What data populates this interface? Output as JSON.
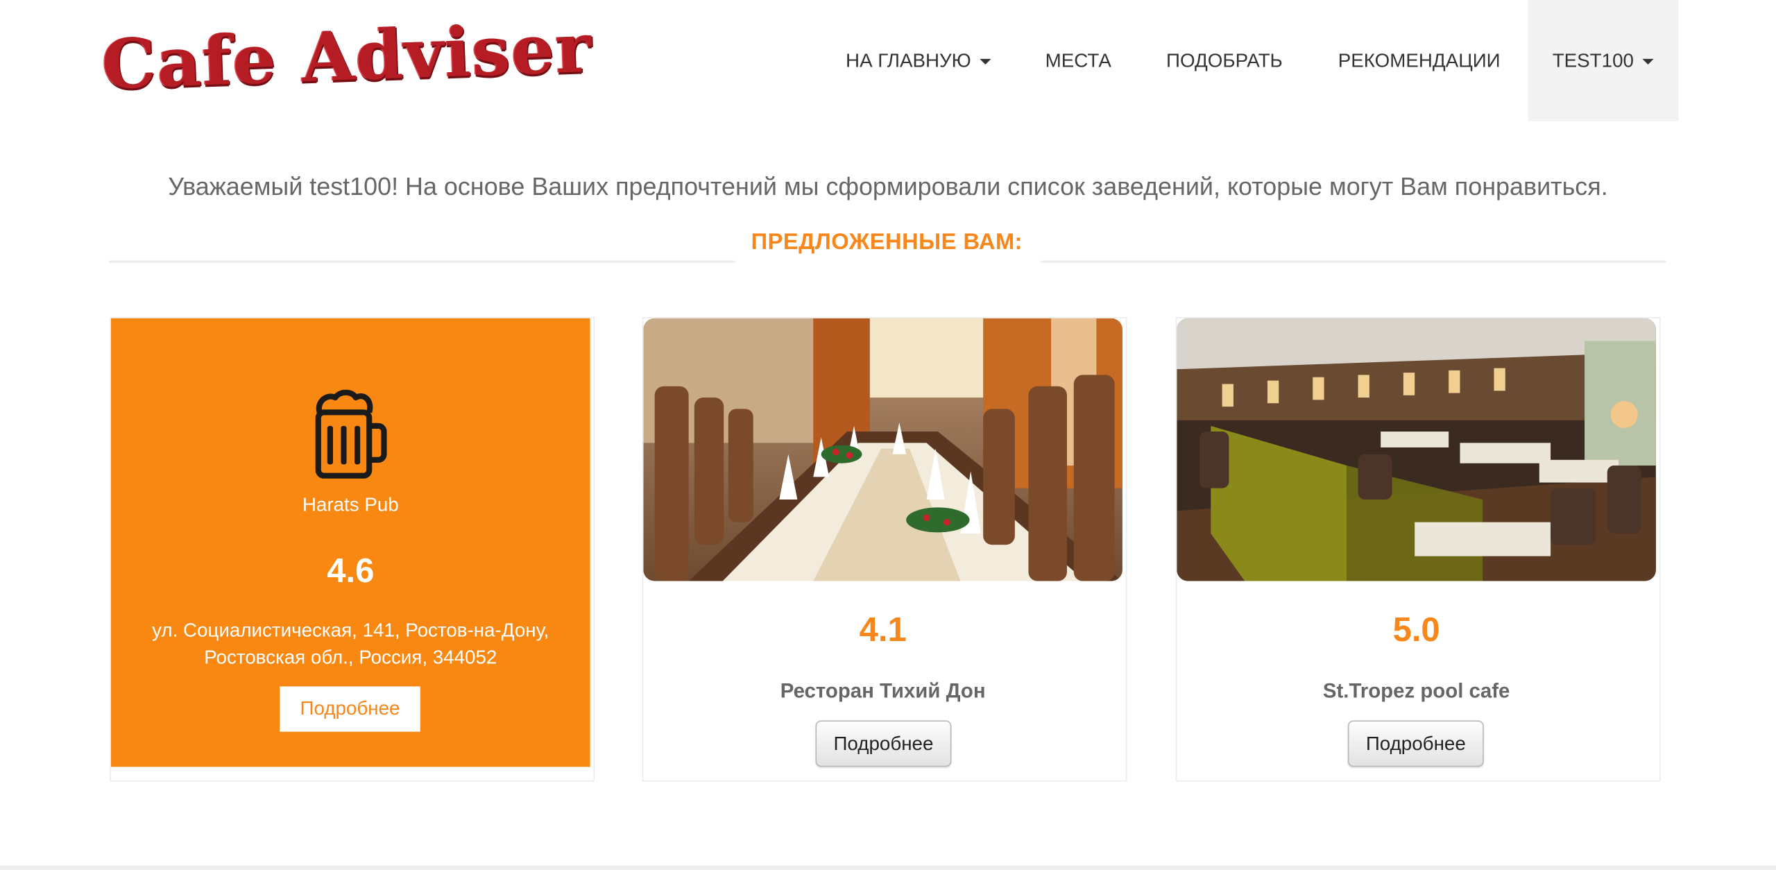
{
  "brand": {
    "logo_text": "Cafe Adviser"
  },
  "nav": {
    "home": "НА ГЛАВНУЮ",
    "places": "МЕСТА",
    "pick": "ПОДОБРАТЬ",
    "recommendations": "РЕКОМЕНДАЦИИ",
    "user": "TEST100"
  },
  "intro_text": "Уважаемый test100! На основе Ваших предпочтений мы сформировали список заведений, которые могут Вам понравиться.",
  "section_title": "ПРЕДЛОЖЕННЫЕ ВАМ:",
  "featured": {
    "icon": "beer-mug-icon",
    "name": "Harats Pub",
    "rating": "4.6",
    "address": "ул. Социалистическая, 141, Ростов-на-Дону, Ростовская обл., Россия, 344052",
    "button": "Подробнее"
  },
  "cards": [
    {
      "rating": "4.1",
      "name": "Ресторан Тихий Дон",
      "button": "Подробнее"
    },
    {
      "rating": "5.0",
      "name": "St.Tropez pool cafe",
      "button": "Подробнее"
    }
  ],
  "colors": {
    "accent": "#f98812",
    "accent_text": "#f7861b",
    "nav_active_bg": "#f3f3f3"
  }
}
